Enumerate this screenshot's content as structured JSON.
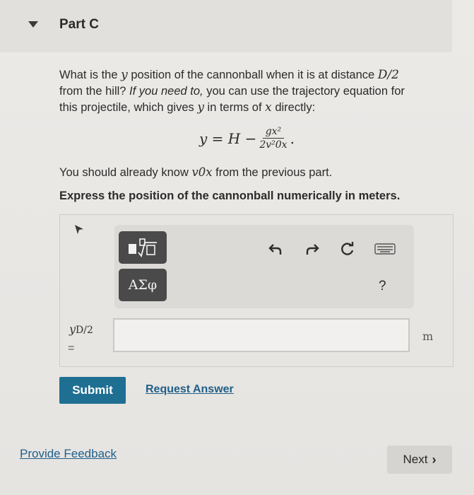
{
  "part": {
    "title": "Part C"
  },
  "question": {
    "line1_a": "What is the ",
    "line1_var": "y",
    "line1_b": " position of the cannonball when it is at distance ",
    "line1_dist": "D/2",
    "line2_a": "from the hill? ",
    "line2_hint": "If you need to,",
    "line2_b": " you can use the trajectory equation for",
    "line3_a": "this projectile, which gives ",
    "line3_y": "y",
    "line3_b": " in terms of ",
    "line3_x": "x",
    "line3_c": " directly:"
  },
  "equation": {
    "lhs": "y = H −",
    "numerator": "gx²",
    "denominator": "2v²0x",
    "tail": "."
  },
  "know": {
    "a": "You should already know ",
    "var": "v0x",
    "b": " from the previous part."
  },
  "instruction": "Express the position of the cannonball numerically in meters.",
  "toolbar": {
    "template_icon": "template-icon",
    "greek_label": "ΑΣφ",
    "undo_icon": "undo-icon",
    "redo_icon": "redo-icon",
    "reset_icon": "reset-icon",
    "keyboard_icon": "keyboard-icon",
    "help_label": "?"
  },
  "answer": {
    "variable": "y",
    "variable_sub": "D/2",
    "equals": "=",
    "value": "",
    "unit": "m"
  },
  "actions": {
    "submit_label": "Submit",
    "request_label": "Request Answer",
    "feedback_label": "Provide Feedback",
    "next_label": "Next"
  }
}
